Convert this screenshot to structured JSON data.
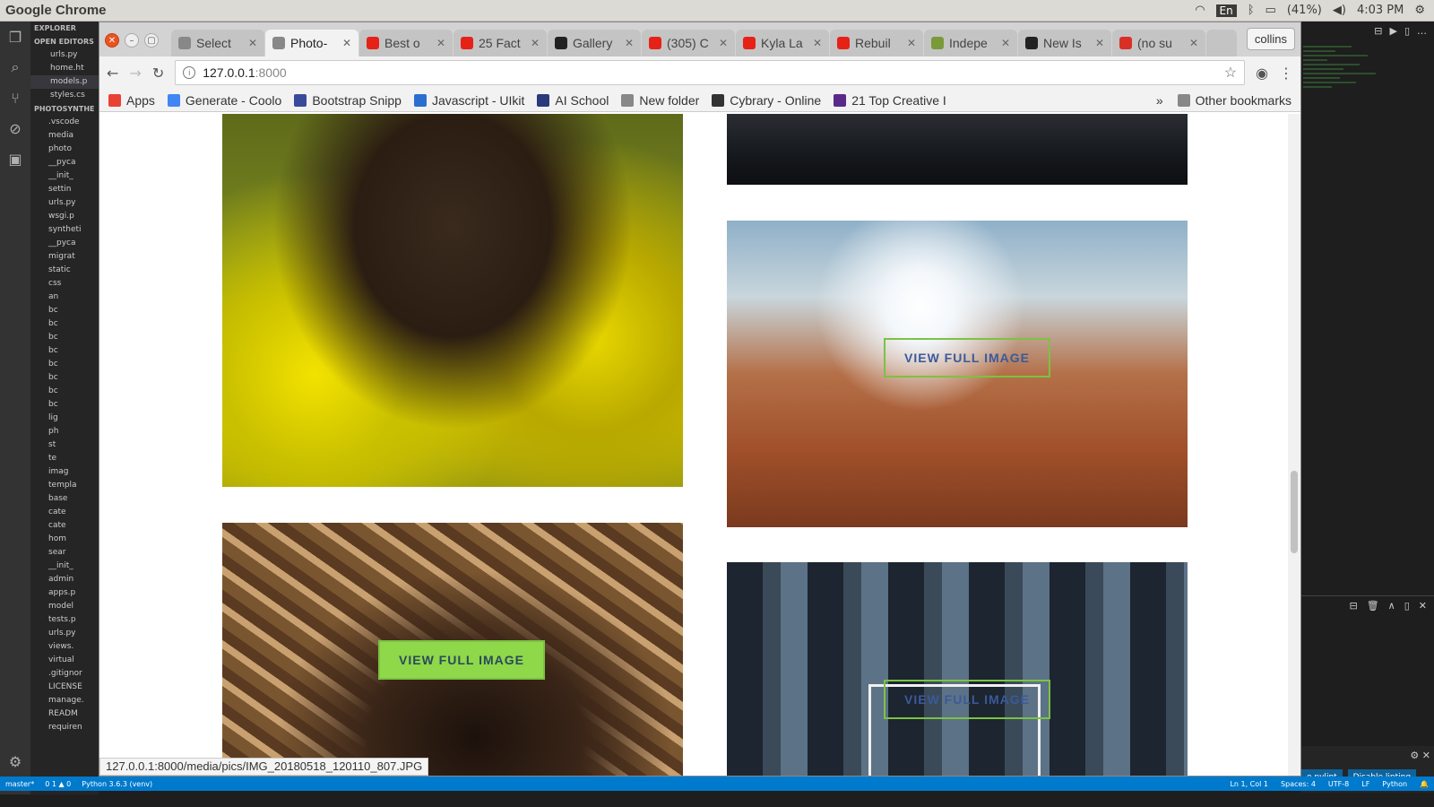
{
  "os_bar": {
    "app_name": "Google Chrome",
    "lang": "En",
    "battery": "(41%)",
    "time": "4:03 PM"
  },
  "vscode": {
    "explorer_label": "EXPLORER",
    "open_editors": "OPEN EDITORS",
    "project": "PHOTOSYNTHE",
    "open_files": [
      "urls.py",
      "home.ht",
      "models.p",
      "styles.cs"
    ],
    "tree": [
      ".vscode",
      "media",
      "photo",
      "__pyca",
      "__init_",
      "settin",
      "urls.py",
      "wsgi.p",
      "syntheti",
      "__pyca",
      "migrat",
      "static",
      "css",
      "an",
      "bc",
      "bc",
      "bc",
      "bc",
      "bc",
      "bc",
      "bc",
      "bc",
      "lig",
      "ph",
      "st",
      "te",
      "imag",
      "templa",
      "base",
      "cate",
      "cate",
      "hom",
      "sear",
      "__init_",
      "admin",
      "apps.p",
      "model",
      "tests.p",
      "urls.py",
      "views.",
      "virtual",
      ".gitignor",
      "LICENSE",
      "manage.",
      "READM",
      "requiren"
    ],
    "status_left": [
      "master*",
      "0 1 ▲ 0",
      "Python 3.6.3 (venv)"
    ],
    "status_right": [
      "Ln 1, Col 1",
      "Spaces: 4",
      "UTF-8",
      "LF",
      "Python"
    ],
    "notif_btn1": "e pylint",
    "notif_btn2": "Disable linting"
  },
  "browser": {
    "tabs": [
      {
        "title": "Select",
        "fav": "doc",
        "active": false
      },
      {
        "title": "Photo-",
        "fav": "doc",
        "active": true
      },
      {
        "title": "Best o",
        "fav": "yt",
        "active": false
      },
      {
        "title": "25 Fact",
        "fav": "yt",
        "active": false
      },
      {
        "title": "Gallery",
        "fav": "gh",
        "active": false
      },
      {
        "title": "(305) C",
        "fav": "yt",
        "active": false
      },
      {
        "title": "Kyla La",
        "fav": "yt",
        "active": false
      },
      {
        "title": "Rebuil",
        "fav": "yt",
        "active": false
      },
      {
        "title": "Indepe",
        "fav": "leaf",
        "active": false
      },
      {
        "title": "New Is",
        "fav": "gh",
        "active": false
      },
      {
        "title": "(no su",
        "fav": "gmail",
        "active": false
      }
    ],
    "profile": "collins",
    "url_host": "127.0.0.1",
    "url_port": ":8000",
    "bookmarks": [
      "Apps",
      "Generate - Coolo",
      "Bootstrap Snipp",
      "Javascript - UIkit",
      "AI School",
      "New folder",
      "Cybrary - Online",
      "21 Top Creative I"
    ],
    "bookmarks_more": "»",
    "other_bookmarks": "Other bookmarks",
    "hover_url": "127.0.0.1:8000/media/pics/IMG_20180518_120110_807.JPG"
  },
  "gallery": {
    "button_label": "VIEW FULL IMAGE"
  }
}
